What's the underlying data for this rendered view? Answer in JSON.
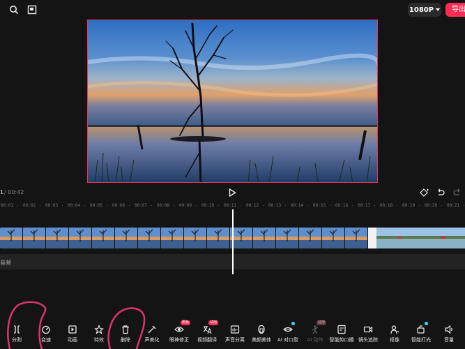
{
  "topbar": {
    "close_icon": "close-icon",
    "fullscreen_icon": "fullscreen-icon",
    "resolution": "1080P",
    "export_label": "导出"
  },
  "preview": {
    "image": "lake-sunset-with-bare-tree"
  },
  "playback": {
    "current_time": "1",
    "separator_total": " / 00:42",
    "play_icon": "play-icon",
    "keyframe_icon": "keyframe-icon",
    "undo_icon": "undo-icon",
    "redo_icon": "redo-icon"
  },
  "timeline": {
    "ticks": [
      "00:01",
      "00:02",
      "00:03",
      "00:04",
      "00:05",
      "00:06",
      "00:07",
      "00:08",
      "00:09",
      "00:10",
      "00:11",
      "00:12",
      "00:13",
      "00:14",
      "00:15",
      "00:16",
      "00:17",
      "00:18",
      "00:19",
      "00:20",
      "00:21"
    ],
    "audio_label": "音频"
  },
  "toolbar": {
    "items": [
      {
        "label": "分割",
        "icon": "split-icon"
      },
      {
        "label": "变速",
        "icon": "speed-icon"
      },
      {
        "label": "动画",
        "icon": "animation-icon"
      },
      {
        "label": "特效",
        "icon": "effects-icon"
      },
      {
        "label": "删除",
        "icon": "delete-icon"
      },
      {
        "label": "声美化",
        "icon": "voice-beautify-icon"
      },
      {
        "label": "眼神修正",
        "icon": "eye-correct-icon",
        "badge": "限免"
      },
      {
        "label": "视频翻译",
        "icon": "translate-icon",
        "badge": "试用"
      },
      {
        "label": "声音分离",
        "icon": "audio-separate-icon"
      },
      {
        "label": "美颜美体",
        "icon": "beauty-icon"
      },
      {
        "label": "AI 对口型",
        "icon": "lip-sync-icon"
      },
      {
        "label": "AI 动作",
        "icon": "ai-motion-icon",
        "badge": "试用"
      },
      {
        "label": "智能剪口播",
        "icon": "smart-cut-icon"
      },
      {
        "label": "镜头追踪",
        "icon": "camera-track-icon"
      },
      {
        "label": "抠像",
        "icon": "cutout-icon"
      },
      {
        "label": "智能打光",
        "icon": "smart-light-icon"
      },
      {
        "label": "音量",
        "icon": "volume-icon"
      }
    ]
  },
  "colors": {
    "accent": "#fe2c55",
    "background": "#141414"
  }
}
